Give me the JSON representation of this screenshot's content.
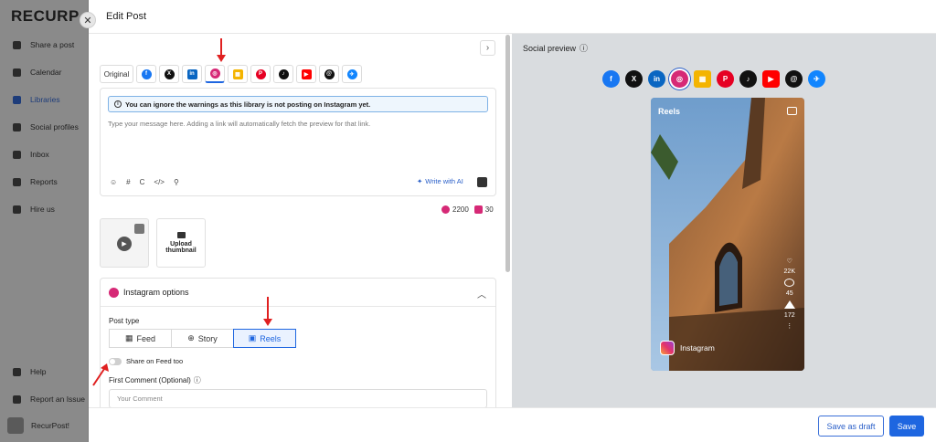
{
  "app": {
    "logo": "RECURP",
    "nav": [
      {
        "label": "Share a post",
        "icon": "send-icon"
      },
      {
        "label": "Calendar",
        "icon": "calendar-icon"
      },
      {
        "label": "Libraries",
        "icon": "library-icon"
      },
      {
        "label": "Social profiles",
        "icon": "profile-icon"
      },
      {
        "label": "Inbox",
        "icon": "inbox-icon"
      },
      {
        "label": "Reports",
        "icon": "reports-icon"
      },
      {
        "label": "Hire us",
        "icon": "hire-icon"
      }
    ],
    "bottom_nav": [
      {
        "label": "Help",
        "icon": "help-icon"
      },
      {
        "label": "Report an Issue",
        "icon": "report-issue-icon"
      }
    ],
    "user": "RecurPost!"
  },
  "modal": {
    "title": "Edit Post",
    "close": "✕",
    "collapse": "›",
    "tabs": [
      {
        "label": "Original",
        "icon": "",
        "color": ""
      },
      {
        "label": "f",
        "icon": "facebook-icon",
        "color": "#1877f2"
      },
      {
        "label": "X",
        "icon": "x-icon",
        "color": "#111111"
      },
      {
        "label": "in",
        "icon": "linkedin-icon",
        "color": "#0a66c2"
      },
      {
        "label": "◎",
        "icon": "instagram-icon",
        "color": "#d62976"
      },
      {
        "label": "▦",
        "icon": "google-business-icon",
        "color": "#f4b400"
      },
      {
        "label": "P",
        "icon": "pinterest-icon",
        "color": "#e60023"
      },
      {
        "label": "♪",
        "icon": "tiktok-icon",
        "color": "#111111"
      },
      {
        "label": "▶",
        "icon": "youtube-icon",
        "color": "#ff0000"
      },
      {
        "label": "@",
        "icon": "threads-icon",
        "color": "#111111"
      },
      {
        "label": "✈",
        "icon": "bluesky-icon",
        "color": "#1185fe"
      }
    ],
    "warning": "You can ignore the warnings as this library is not posting on Instagram yet.",
    "message_placeholder": "Type your message here. Adding a link will automatically fetch the preview for that link.",
    "editor_tools": [
      "☺",
      "#",
      "C",
      "</>",
      "⚲"
    ],
    "write_ai": "Write with AI",
    "counts": [
      {
        "value": "2200",
        "icon": "instagram-icon"
      },
      {
        "value": "30",
        "icon": "hashtag-icon"
      }
    ],
    "upload_thumbnail": "Upload thumbnail",
    "instagram_options": {
      "title": "Instagram options",
      "post_type_label": "Post type",
      "post_types": [
        {
          "label": "Feed",
          "icon": "grid-icon",
          "active": false
        },
        {
          "label": "Story",
          "icon": "story-icon",
          "active": false
        },
        {
          "label": "Reels",
          "icon": "reels-icon",
          "active": true
        }
      ],
      "share_on_feed": "Share on Feed too",
      "first_comment_label": "First Comment (Optional)",
      "first_comment_placeholder": "Your Comment"
    },
    "preview": {
      "title": "Social preview",
      "icons": [
        {
          "label": "f",
          "icon": "facebook-icon",
          "color": "#1877f2"
        },
        {
          "label": "X",
          "icon": "x-icon",
          "color": "#111111"
        },
        {
          "label": "in",
          "icon": "linkedin-icon",
          "color": "#0a66c2"
        },
        {
          "label": "◎",
          "icon": "instagram-icon",
          "color": "#d62976"
        },
        {
          "label": "▦",
          "icon": "google-business-icon",
          "color": "#f4b400"
        },
        {
          "label": "P",
          "icon": "pinterest-icon",
          "color": "#e60023"
        },
        {
          "label": "♪",
          "icon": "tiktok-icon",
          "color": "#111111"
        },
        {
          "label": "▶",
          "icon": "youtube-icon",
          "color": "#ff0000"
        },
        {
          "label": "@",
          "icon": "threads-icon",
          "color": "#111111"
        },
        {
          "label": "✈",
          "icon": "bluesky-icon",
          "color": "#1185fe"
        }
      ],
      "reels_label": "Reels",
      "likes": "22K",
      "comments": "45",
      "shares": "172",
      "account": "Instagram"
    },
    "footer": {
      "save_draft": "Save as draft",
      "save": "Save"
    }
  },
  "colors": {
    "accent": "#1e66e0",
    "annotation_arrow": "#e02020"
  }
}
